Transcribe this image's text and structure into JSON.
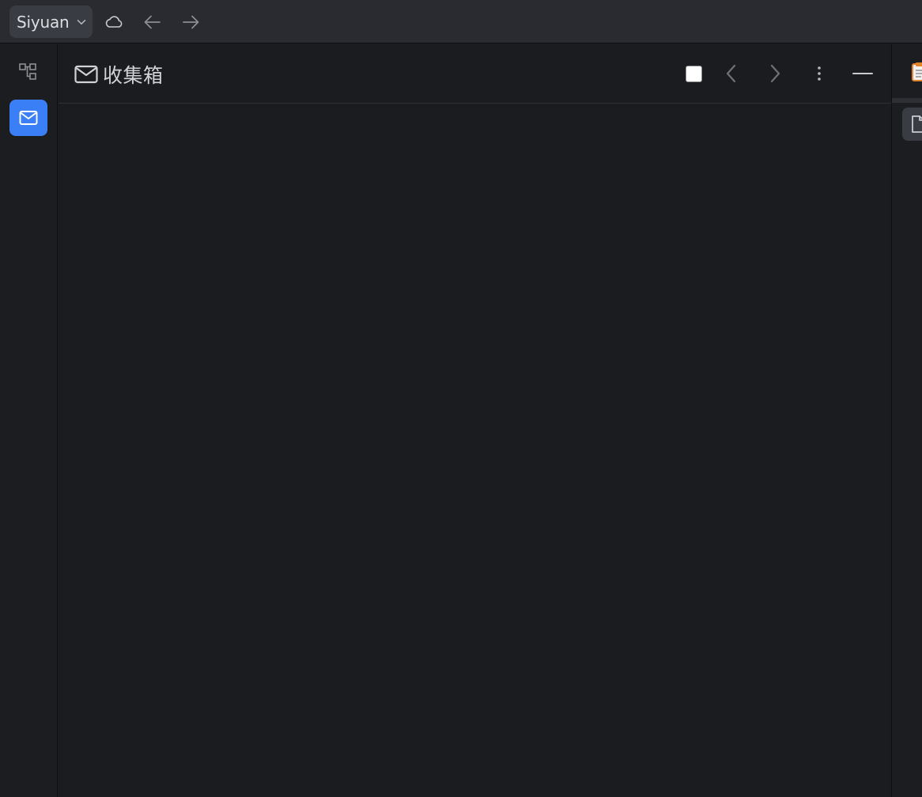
{
  "topbar": {
    "workspace_label": "Siyuan",
    "workspace_chevron_icon": "chevron-down-icon",
    "sync_icon": "cloud-icon",
    "back_icon": "arrow-left-icon",
    "forward_icon": "arrow-right-icon"
  },
  "left_dock": {
    "items": [
      {
        "icon": "file-tree-icon",
        "active": false
      },
      {
        "icon": "mail-icon",
        "active": true
      }
    ]
  },
  "panel": {
    "title_icon": "mail-icon",
    "title": "收集箱",
    "controls": [
      {
        "icon": "select-all-checkbox",
        "checked": false
      },
      {
        "icon": "chevron-left-icon"
      },
      {
        "icon": "chevron-right-icon"
      },
      {
        "icon": "more-vertical-icon"
      },
      {
        "icon": "minimize-icon"
      }
    ]
  },
  "right_dock": {
    "tab_icon": "clipboard-icon",
    "item_icon": "document-icon"
  },
  "colors": {
    "topbar_bg": "#2a2b30",
    "panel_bg": "#1b1c1f",
    "accent": "#3b7ff6",
    "text": "#d0d2d6"
  }
}
